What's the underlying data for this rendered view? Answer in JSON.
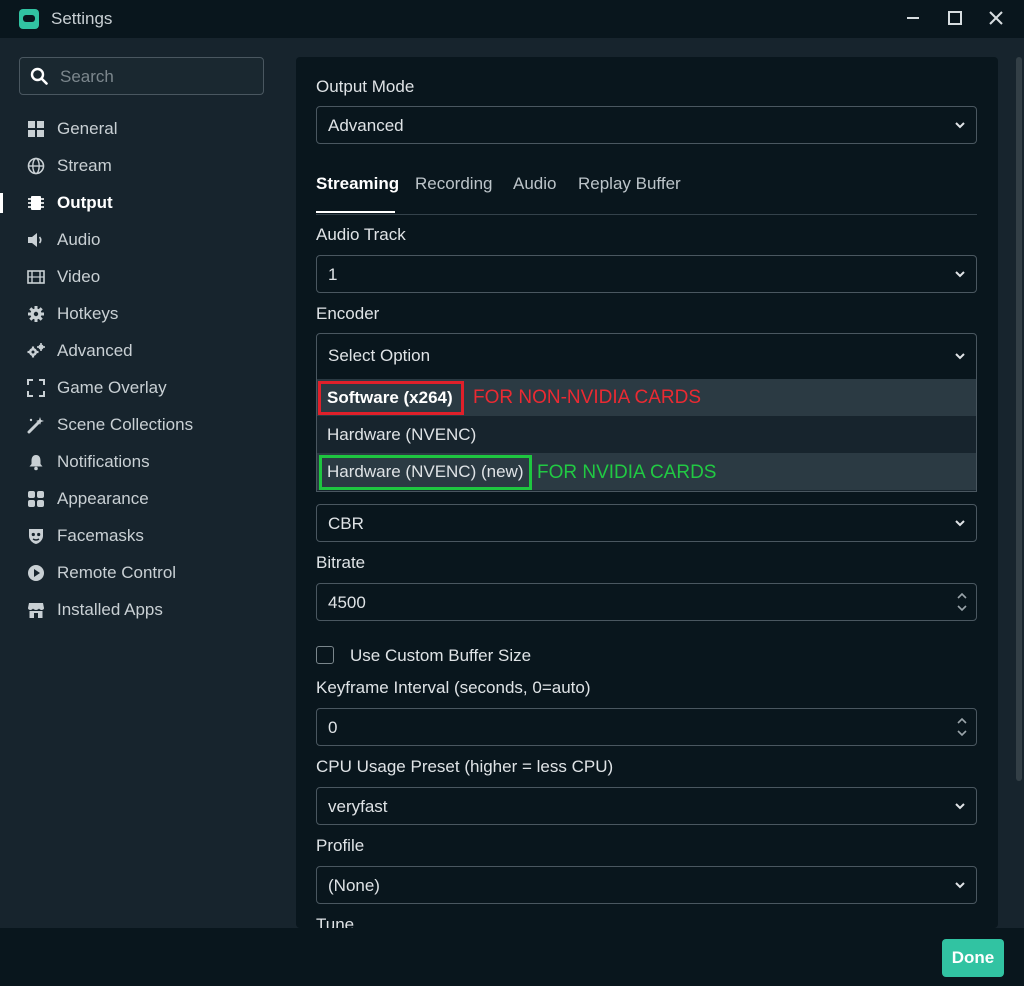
{
  "window": {
    "title": "Settings",
    "minimize": "—",
    "maximize": "☐",
    "close": "✕"
  },
  "search": {
    "placeholder": "Search",
    "value": ""
  },
  "sidebar": {
    "items": [
      {
        "label": "General",
        "icon": "grid-icon"
      },
      {
        "label": "Stream",
        "icon": "globe-icon"
      },
      {
        "label": "Output",
        "icon": "chip-icon",
        "active": true
      },
      {
        "label": "Audio",
        "icon": "speaker-icon"
      },
      {
        "label": "Video",
        "icon": "film-icon"
      },
      {
        "label": "Hotkeys",
        "icon": "gear-icon"
      },
      {
        "label": "Advanced",
        "icon": "gears-icon"
      },
      {
        "label": "Game Overlay",
        "icon": "expand-icon"
      },
      {
        "label": "Scene Collections",
        "icon": "magic-icon"
      },
      {
        "label": "Notifications",
        "icon": "bell-icon"
      },
      {
        "label": "Appearance",
        "icon": "tiles-icon"
      },
      {
        "label": "Facemasks",
        "icon": "mask-icon"
      },
      {
        "label": "Remote Control",
        "icon": "play-icon"
      },
      {
        "label": "Installed Apps",
        "icon": "store-icon"
      }
    ]
  },
  "output": {
    "mode_label": "Output Mode",
    "mode_value": "Advanced",
    "tabs": [
      "Streaming",
      "Recording",
      "Audio",
      "Replay Buffer"
    ],
    "audio_track_label": "Audio Track",
    "audio_track_value": "1",
    "encoder_label": "Encoder",
    "encoder_value": "Select Option",
    "encoder_options": [
      "Software (x264)",
      "Hardware (NVENC)",
      "Hardware (NVENC) (new)"
    ],
    "annotation_red": "FOR NON-NVIDIA CARDS",
    "annotation_green": "FOR NVIDIA CARDS",
    "rate_control_value": "CBR",
    "bitrate_label": "Bitrate",
    "bitrate_value": "4500",
    "custom_buffer_label": "Use Custom Buffer Size",
    "custom_buffer_checked": false,
    "keyframe_label": "Keyframe Interval (seconds, 0=auto)",
    "keyframe_value": "0",
    "cpu_preset_label": "CPU Usage Preset (higher = less CPU)",
    "cpu_preset_value": "veryfast",
    "profile_label": "Profile",
    "profile_value": "(None)",
    "tune_label": "Tune"
  },
  "footer": {
    "done_label": "Done"
  },
  "colors": {
    "accent": "#31c3a2",
    "annotation_red": "#e0202a",
    "annotation_green": "#1ec640",
    "panel_bg": "#09161d",
    "sidebar_bg": "#17242d"
  }
}
